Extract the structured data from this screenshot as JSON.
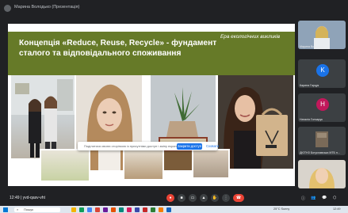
{
  "presenter": {
    "name": "Марина Володько (Презентація)"
  },
  "slide": {
    "title": "Концепція «Reduce, Reuse, Recycle» - фундамент сталого та відповідального споживання",
    "subtitle": "Ера екологічних викликів",
    "banner_color": "#667a28"
  },
  "notification": {
    "text": "Поділитися своєю сторінкою із присутніми доступ і зміну екрану",
    "allow_label": "Закрити доступ",
    "close_label": "Сховати"
  },
  "participants": [
    {
      "name": "Марина Володько",
      "type": "video"
    },
    {
      "name": "Карина Гарцук",
      "initial": "K",
      "color": "#1a73e8"
    },
    {
      "name": "Наталія Гончарук",
      "initial": "Н",
      "color": "#c2185b"
    },
    {
      "name": "ДЮТНЗ Богуславська МТБ н...",
      "type": "image"
    },
    {
      "name": "",
      "type": "video"
    }
  ],
  "bottom_bar": {
    "time": "12:49",
    "meeting_code": "yvd-qasv-vht"
  },
  "taskbar": {
    "search_placeholder": "Пошук",
    "weather": "25°C Sunny",
    "clock": "12:49"
  }
}
